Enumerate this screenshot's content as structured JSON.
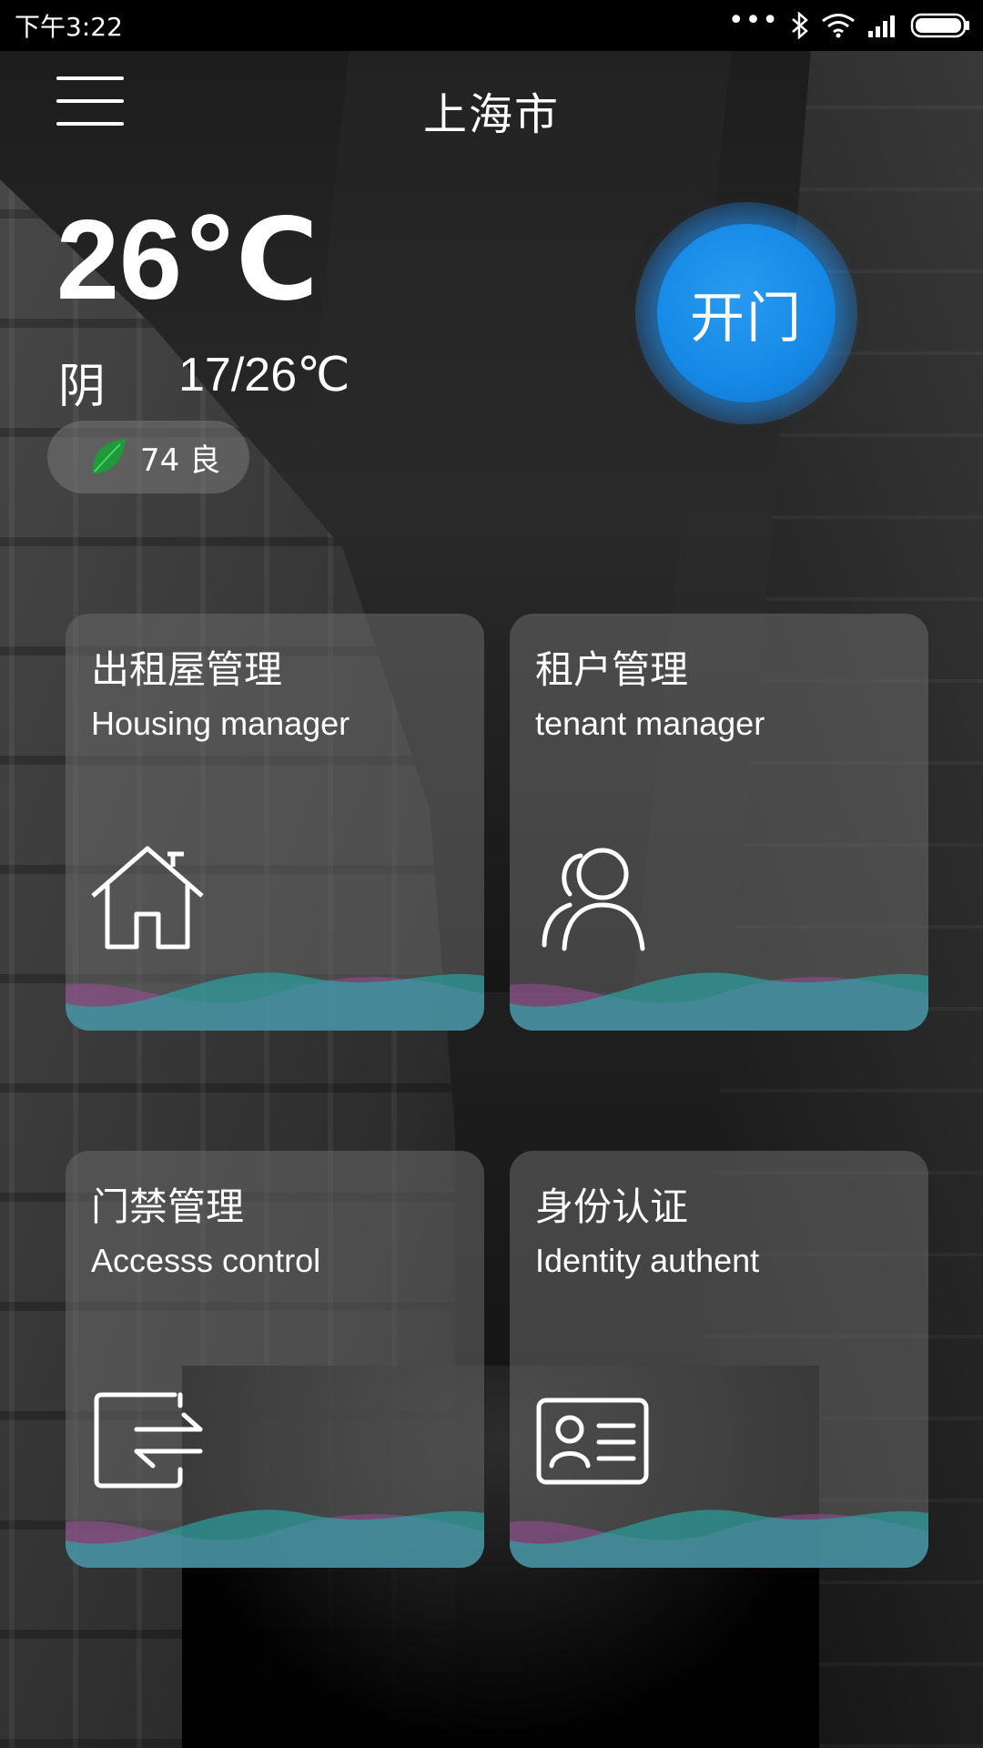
{
  "status_bar": {
    "time": "下午3:22",
    "icons": [
      "more-dots-icon",
      "bluetooth-icon",
      "wifi-icon",
      "signal-icon",
      "battery-icon"
    ]
  },
  "header": {
    "menu_icon": "hamburger-menu-icon",
    "city": "上海市"
  },
  "weather": {
    "temperature": "26℃",
    "condition": "阴",
    "range": "17/26℃",
    "aqi": "74 良",
    "aqi_icon": "leaf-icon"
  },
  "open_door": {
    "label": "开门",
    "color": "#1589e6"
  },
  "tiles": [
    {
      "title_cn": "出租屋管理",
      "title_en": "Housing manager",
      "icon": "house-icon"
    },
    {
      "title_cn": "租户管理",
      "title_en": "tenant manager",
      "icon": "users-icon"
    },
    {
      "title_cn": "门禁管理",
      "title_en": "Accesss control",
      "icon": "access-exchange-icon"
    },
    {
      "title_cn": "身份认证",
      "title_en": "Identity authent",
      "icon": "id-card-icon"
    }
  ],
  "colors": {
    "wave_teal": "#2aa7a7",
    "wave_purple": "#9a4f9a",
    "tile_bg": "rgba(105,105,105,0.55)"
  }
}
